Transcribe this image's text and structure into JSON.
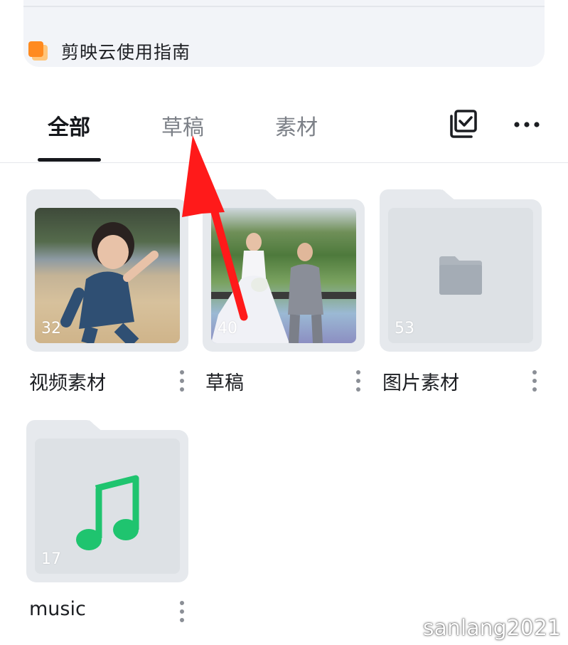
{
  "guide": {
    "label": "剪映云使用指南",
    "icon": "document-stack-icon"
  },
  "tabs": [
    {
      "label": "全部",
      "active": true
    },
    {
      "label": "草稿",
      "active": false
    },
    {
      "label": "素材",
      "active": false
    }
  ],
  "toolbar": {
    "select_icon": "multi-select-check-icon",
    "more_icon": "more-horizontal-icon"
  },
  "folders": [
    {
      "label": "视频素材",
      "count": "32",
      "thumbnail": "child-on-beach-photo"
    },
    {
      "label": "草稿",
      "count": "40",
      "thumbnail": "wedding-couple-photo"
    },
    {
      "label": "图片素材",
      "count": "53",
      "thumbnail": "folder-icon"
    },
    {
      "label": "music",
      "count": "17",
      "thumbnail": "music-note-icon"
    }
  ],
  "colors": {
    "accent_orange": "#ff8a1f",
    "music_green": "#1fc46f",
    "annotation_red": "#ff1a1a"
  },
  "watermark": "sanlang2021"
}
